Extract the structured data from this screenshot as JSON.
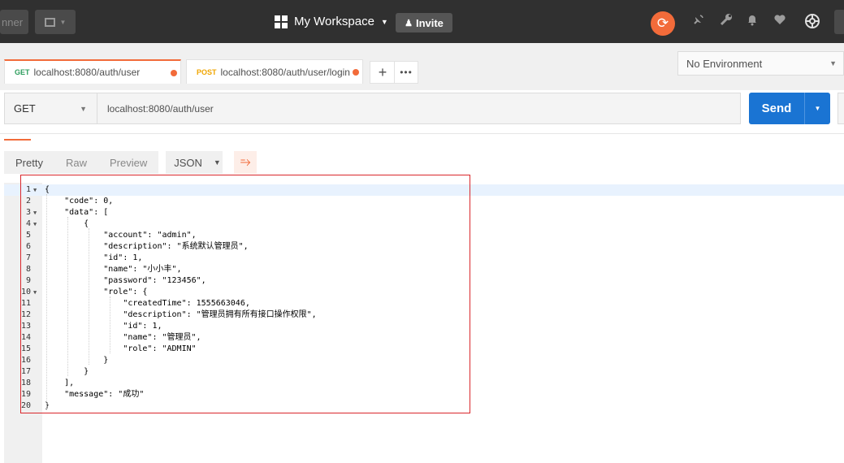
{
  "topbar": {
    "runner_label": "nner",
    "workspace_label": "My Workspace",
    "invite_label": "Invite",
    "accent_color": "#f26b3a",
    "icons": [
      "satellite-icon",
      "wrench-icon",
      "bell-icon",
      "heart-icon",
      "settings-icon"
    ]
  },
  "tabs": [
    {
      "method": "GET",
      "url": "localhost:8080/auth/user",
      "method_color": "#2e9e5e"
    },
    {
      "method": "POST",
      "url": "localhost:8080/auth/user/login",
      "method_color": "#f0a500"
    }
  ],
  "environment": {
    "selected": "No Environment"
  },
  "request": {
    "method": "GET",
    "url": "localhost:8080/auth/user",
    "send_label": "Send"
  },
  "response_view": {
    "modes": [
      "Pretty",
      "Raw",
      "Preview"
    ],
    "active": "Pretty",
    "format": "JSON"
  },
  "code_lines": [
    "{",
    "    \"code\": 0,",
    "    \"data\": [",
    "        {",
    "            \"account\": \"admin\",",
    "            \"description\": \"系统默认管理员\",",
    "            \"id\": 1,",
    "            \"name\": \"小小丰\",",
    "            \"password\": \"123456\",",
    "            \"role\": {",
    "                \"createdTime\": 1555663046,",
    "                \"description\": \"管理员拥有所有接口操作权限\",",
    "                \"id\": 1,",
    "                \"name\": \"管理员\",",
    "                \"role\": \"ADMIN\"",
    "            }",
    "        }",
    "    ],",
    "    \"message\": \"成功\"",
    "}"
  ],
  "foldable_lines": [
    1,
    3,
    4,
    10
  ]
}
